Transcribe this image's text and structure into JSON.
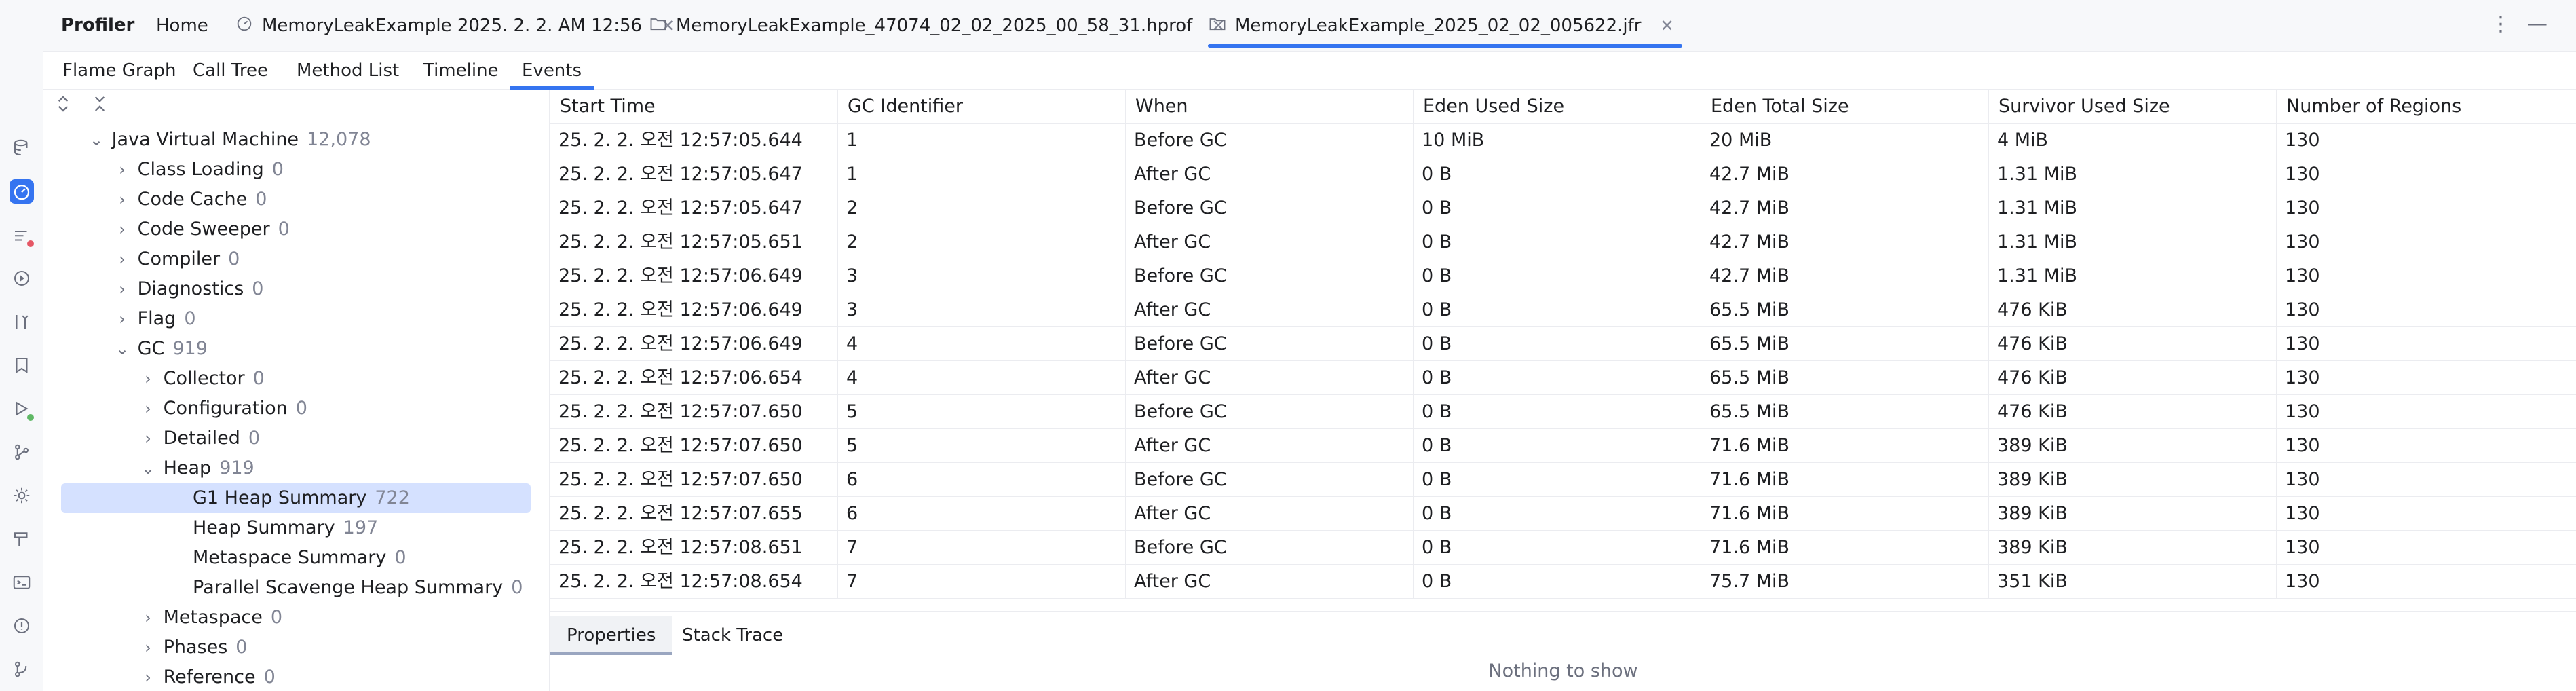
{
  "app": {
    "title": "Profiler"
  },
  "file_tabs": [
    {
      "label": "Home"
    },
    {
      "label": "MemoryLeakExample 2025. 2. 2. AM 12:56"
    },
    {
      "label": "MemoryLeakExample_47074_02_02_2025_00_58_31.hprof"
    },
    {
      "label": "MemoryLeakExample_2025_02_02_005622.jfr"
    }
  ],
  "view_tabs": [
    {
      "label": "Flame Graph"
    },
    {
      "label": "Call Tree"
    },
    {
      "label": "Method List"
    },
    {
      "label": "Timeline"
    },
    {
      "label": "Events"
    }
  ],
  "icons": {
    "more": "more-vertical-icon",
    "minimize": "minimize-icon",
    "expand_all": "expand-all-icon",
    "collapse_all": "collapse-all-icon"
  },
  "tree": [
    {
      "label": "Java Virtual Machine",
      "count": "12,078"
    },
    {
      "label": "Class Loading",
      "count": "0"
    },
    {
      "label": "Code Cache",
      "count": "0"
    },
    {
      "label": "Code Sweeper",
      "count": "0"
    },
    {
      "label": "Compiler",
      "count": "0"
    },
    {
      "label": "Diagnostics",
      "count": "0"
    },
    {
      "label": "Flag",
      "count": "0"
    },
    {
      "label": "GC",
      "count": "919"
    },
    {
      "label": "Collector",
      "count": "0"
    },
    {
      "label": "Configuration",
      "count": "0"
    },
    {
      "label": "Detailed",
      "count": "0"
    },
    {
      "label": "Heap",
      "count": "919"
    },
    {
      "label": "G1 Heap Summary",
      "count": "722"
    },
    {
      "label": "Heap Summary",
      "count": "197"
    },
    {
      "label": "Metaspace Summary",
      "count": "0"
    },
    {
      "label": "Parallel Scavenge Heap Summary",
      "count": "0"
    },
    {
      "label": "Metaspace",
      "count": "0"
    },
    {
      "label": "Phases",
      "count": "0"
    },
    {
      "label": "Reference",
      "count": "0"
    }
  ],
  "table": {
    "columns": [
      "Start Time",
      "GC Identifier",
      "When",
      "Eden Used Size",
      "Eden Total Size",
      "Survivor Used Size",
      "Number of Regions"
    ],
    "rows": [
      [
        "25. 2. 2. 오전 12:57:05.644",
        "1",
        "Before GC",
        "10 MiB",
        "20 MiB",
        "4 MiB",
        "130"
      ],
      [
        "25. 2. 2. 오전 12:57:05.647",
        "1",
        "After GC",
        "0 B",
        "42.7 MiB",
        "1.31 MiB",
        "130"
      ],
      [
        "25. 2. 2. 오전 12:57:05.647",
        "2",
        "Before GC",
        "0 B",
        "42.7 MiB",
        "1.31 MiB",
        "130"
      ],
      [
        "25. 2. 2. 오전 12:57:05.651",
        "2",
        "After GC",
        "0 B",
        "42.7 MiB",
        "1.31 MiB",
        "130"
      ],
      [
        "25. 2. 2. 오전 12:57:06.649",
        "3",
        "Before GC",
        "0 B",
        "42.7 MiB",
        "1.31 MiB",
        "130"
      ],
      [
        "25. 2. 2. 오전 12:57:06.649",
        "3",
        "After GC",
        "0 B",
        "65.5 MiB",
        "476 KiB",
        "130"
      ],
      [
        "25. 2. 2. 오전 12:57:06.649",
        "4",
        "Before GC",
        "0 B",
        "65.5 MiB",
        "476 KiB",
        "130"
      ],
      [
        "25. 2. 2. 오전 12:57:06.654",
        "4",
        "After GC",
        "0 B",
        "65.5 MiB",
        "476 KiB",
        "130"
      ],
      [
        "25. 2. 2. 오전 12:57:07.650",
        "5",
        "Before GC",
        "0 B",
        "65.5 MiB",
        "476 KiB",
        "130"
      ],
      [
        "25. 2. 2. 오전 12:57:07.650",
        "5",
        "After GC",
        "0 B",
        "71.6 MiB",
        "389 KiB",
        "130"
      ],
      [
        "25. 2. 2. 오전 12:57:07.650",
        "6",
        "Before GC",
        "0 B",
        "71.6 MiB",
        "389 KiB",
        "130"
      ],
      [
        "25. 2. 2. 오전 12:57:07.655",
        "6",
        "After GC",
        "0 B",
        "71.6 MiB",
        "389 KiB",
        "130"
      ],
      [
        "25. 2. 2. 오전 12:57:08.651",
        "7",
        "Before GC",
        "0 B",
        "71.6 MiB",
        "389 KiB",
        "130"
      ],
      [
        "25. 2. 2. 오전 12:57:08.654",
        "7",
        "After GC",
        "0 B",
        "75.7 MiB",
        "351 KiB",
        "130"
      ]
    ]
  },
  "details": {
    "tabs": [
      {
        "label": "Properties"
      },
      {
        "label": "Stack Trace"
      }
    ],
    "empty_text": "Nothing to show"
  },
  "colors": {
    "accent": "#3574f0",
    "selection": "#d5e1ff",
    "error_badge": "#e55765",
    "ok_badge": "#5fb865"
  }
}
